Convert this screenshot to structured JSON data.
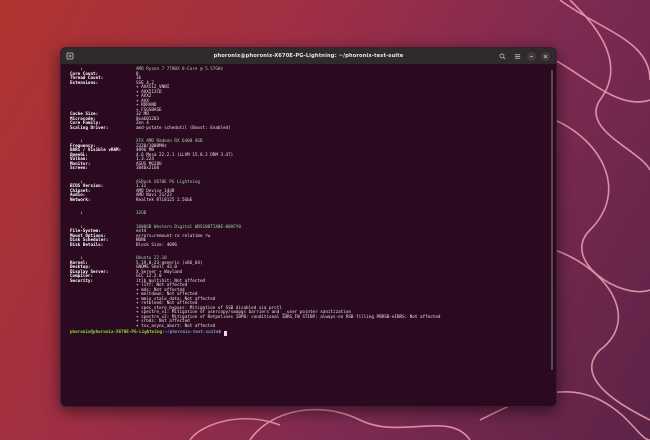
{
  "window": {
    "title": "phoronix@phoronix-X670E-PG-Lightning: ~/phoronix-test-suite"
  },
  "terminal": {
    "sections": [
      {
        "header": "AMD Ryzen 7 7700X 8-Core @ 5.57GHz",
        "rows": [
          {
            "key": "Core Count:",
            "value": "8"
          },
          {
            "key": "Thread Count:",
            "value": "16"
          },
          {
            "key": "Extensions:",
            "value": "SSE 4.2"
          },
          {
            "key": "",
            "value": "+ AVX512_VNNI"
          },
          {
            "key": "",
            "value": "+ AVX512CD"
          },
          {
            "key": "",
            "value": "+ AVX2"
          },
          {
            "key": "",
            "value": "+ AVX"
          },
          {
            "key": "",
            "value": "+ RDRAND"
          },
          {
            "key": "",
            "value": "+ FSGSBASE"
          },
          {
            "key": "Cache Size:",
            "value": "32 MB"
          },
          {
            "key": "Microcode:",
            "value": "0xa601203"
          },
          {
            "key": "Core Family:",
            "value": "Zen 4"
          },
          {
            "key": "Scaling Driver:",
            "value": "amd-pstate schedutil (Boost: Enabled)"
          }
        ]
      },
      {
        "header": "XFX AMD Radeon RX 6400 4GB",
        "rows": [
          {
            "key": "Frequency:",
            "value": "2320/1000MHz"
          },
          {
            "key": "BAR1 / Visible vRAM:",
            "value": "4096 MB"
          },
          {
            "key": "OpenGL:",
            "value": "4.6 Mesa 22.2.1 (LLVM 15.0.2 DRM 3.47)"
          },
          {
            "key": "Vulkan:",
            "value": "1.3.224"
          },
          {
            "key": "Monitor:",
            "value": "ASUS MG28U"
          },
          {
            "key": "Screen:",
            "value": "3840x2160"
          }
        ]
      },
      {
        "header": "ASRock X670E PG Lightning",
        "rows": [
          {
            "key": "BIOS Version:",
            "value": "1.11"
          },
          {
            "key": "Chipset:",
            "value": "AMD Device 14d8"
          },
          {
            "key": "Audio:",
            "value": "AMD Navi 21/23"
          },
          {
            "key": "Network:",
            "value": "Realtek RTL8125 2.5GbE"
          }
        ]
      },
      {
        "header": "32GB",
        "rows": []
      },
      {
        "header": "1000GB Western Digital WDS100T1X0E-00AFY0",
        "rows": [
          {
            "key": "File-System:",
            "value": "ext4"
          },
          {
            "key": "Mount Options:",
            "value": "errors=remount-ro relatime rw"
          },
          {
            "key": "Disk Scheduler:",
            "value": "NONE"
          },
          {
            "key": "Disk Details:",
            "value": "Block Size: 4096"
          }
        ]
      },
      {
        "header": "Ubuntu 22.10",
        "rows": [
          {
            "key": "Kernel:",
            "value": "5.19.0-23-generic (x86_64)"
          },
          {
            "key": "Desktop:",
            "value": "GNOME Shell 43.0"
          },
          {
            "key": "Display Server:",
            "value": "X Server + Wayland"
          },
          {
            "key": "Compiler:",
            "value": "GCC 12.2.0"
          },
          {
            "key": "Security:",
            "value": "itlb_multihit: Not affected"
          },
          {
            "key": "",
            "value": "+ l1tf: Not affected"
          },
          {
            "key": "",
            "value": "+ mds: Not affected"
          },
          {
            "key": "",
            "value": "+ meltdown: Not affected"
          },
          {
            "key": "",
            "value": "+ mmio_stale_data: Not affected"
          },
          {
            "key": "",
            "value": "+ retbleed: Not affected"
          },
          {
            "key": "",
            "value": "+ spec_store_bypass: Mitigation of SSB disabled via prctl"
          },
          {
            "key": "",
            "value": "+ spectre_v1: Mitigation of usercopy/swapgs barriers and __user pointer sanitization"
          },
          {
            "key": "",
            "value": "+ spectre_v2: Mitigation of Retpolines IBPB: conditional IBRS_FW STIBP: always-on RSB filling PBRSB-eIBRS: Not affected"
          },
          {
            "key": "",
            "value": "+ srbds: Not affected"
          },
          {
            "key": "",
            "value": "+ tsx_async_abort: Not affected"
          }
        ]
      }
    ],
    "prompt": {
      "user_host": "phoronix@phoronix-X670E-PG-Lightning",
      "separator": ":",
      "path": "~/phoronix-test-suite",
      "dollar": "$ "
    }
  },
  "colors": {
    "terminal_bg": "#2b0a21",
    "titlebar_bg": "#302a2e",
    "header_green": "#9cd6a4",
    "prompt_green": "#8ae234",
    "prompt_blue": "#729fcf"
  }
}
